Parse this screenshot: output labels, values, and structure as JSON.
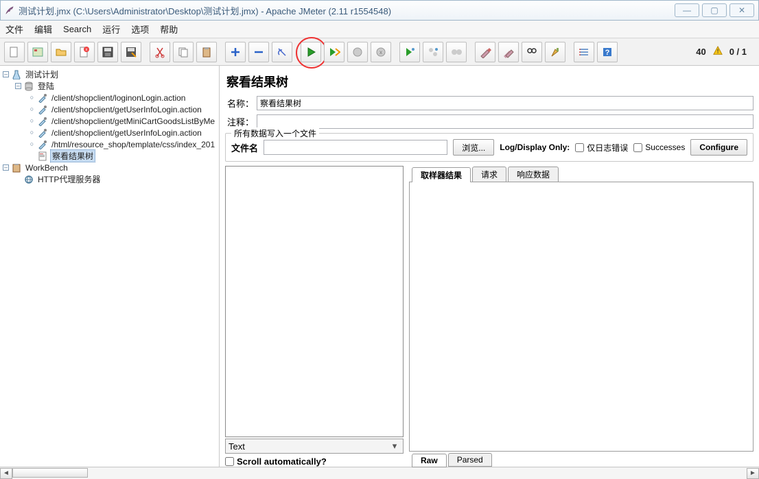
{
  "window": {
    "title": "测试计划.jmx (C:\\Users\\Administrator\\Desktop\\测试计划.jmx) - Apache JMeter (2.11 r1554548)",
    "minimize": "—",
    "maximize": "▢",
    "close": "✕"
  },
  "menu": {
    "file": "文件",
    "edit": "编辑",
    "search": "Search",
    "run": "运行",
    "options": "选项",
    "help": "帮助"
  },
  "status": {
    "count": "40",
    "ratio": "0 / 1"
  },
  "tree": {
    "root": "测试计划",
    "group": "登陆",
    "items": [
      "/client/shopclient/loginonLogin.action",
      "/client/shopclient/getUserInfoLogin.action",
      "/client/shopclient/getMiniCartGoodsListByMe",
      "/client/shopclient/getUserInfoLogin.action",
      "/html/resource_shop/template/css/index_201"
    ],
    "listener": "察看结果树",
    "workbench": "WorkBench",
    "proxy": "HTTP代理服务器"
  },
  "panel": {
    "title": "察看结果树",
    "name_label": "名称：",
    "name_value": "察看结果树",
    "comment_label": "注释：",
    "group_legend": "所有数据写入一个文件",
    "file_label": "文件名",
    "browse": "浏览...",
    "logdisplay": "Log/Display Only:",
    "errors_only": "仅日志错误",
    "successes": "Successes",
    "configure": "Configure",
    "combo_value": "Text",
    "scroll_auto": "Scroll automatically?",
    "tabs": {
      "t1": "取样器结果",
      "t2": "请求",
      "t3": "响应数据"
    },
    "raw_tabs": {
      "raw": "Raw",
      "parsed": "Parsed"
    }
  }
}
